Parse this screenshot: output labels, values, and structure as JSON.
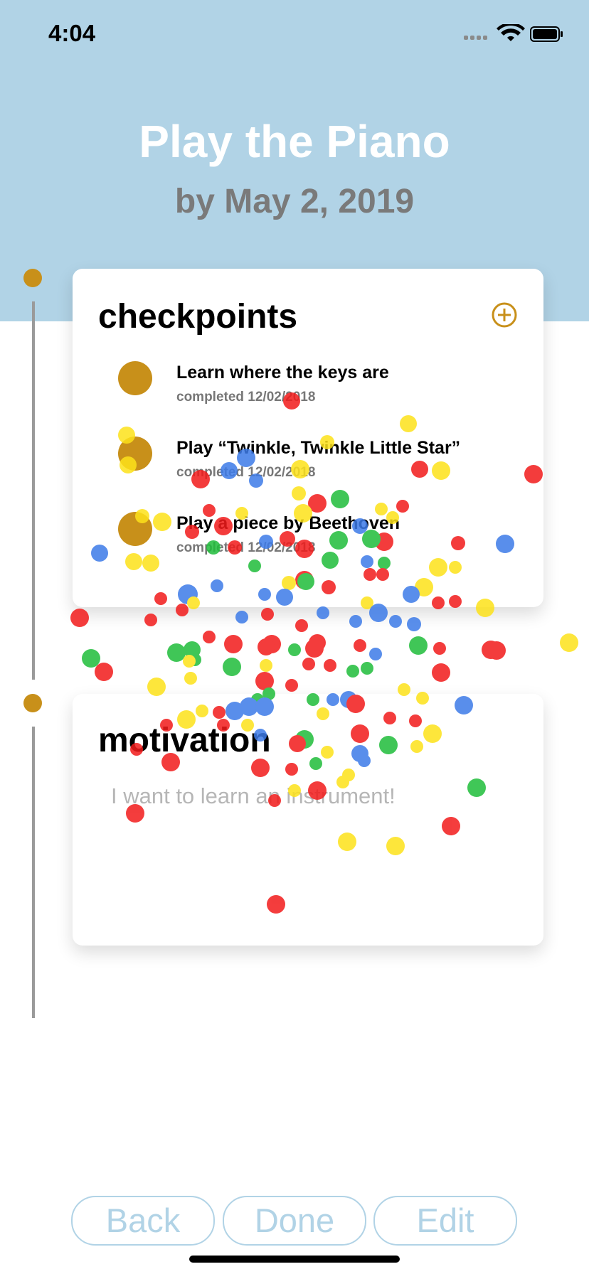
{
  "status_bar": {
    "time": "4:04"
  },
  "goal": {
    "title": "Play the Piano",
    "deadline": "by May 2, 2019"
  },
  "checkpoints": {
    "heading": "checkpoints",
    "items": [
      {
        "label": "Learn where the keys are",
        "status": "completed 12/02/2018"
      },
      {
        "label": "Play “Twinkle, Twinkle Little Star”",
        "status": "completed 12/02/2018"
      },
      {
        "label": "Play a piece by Beethoven",
        "status": "completed 12/02/2018"
      }
    ]
  },
  "motivation": {
    "heading": "motivation",
    "text": "I want to learn an instrument!"
  },
  "actions": {
    "back_label": "Back",
    "done_label": "Done",
    "edit_label": "Edit"
  },
  "colors": {
    "header": "#b1d3e6",
    "accent": "#c8901a",
    "button_outline": "#b1d3e6"
  }
}
